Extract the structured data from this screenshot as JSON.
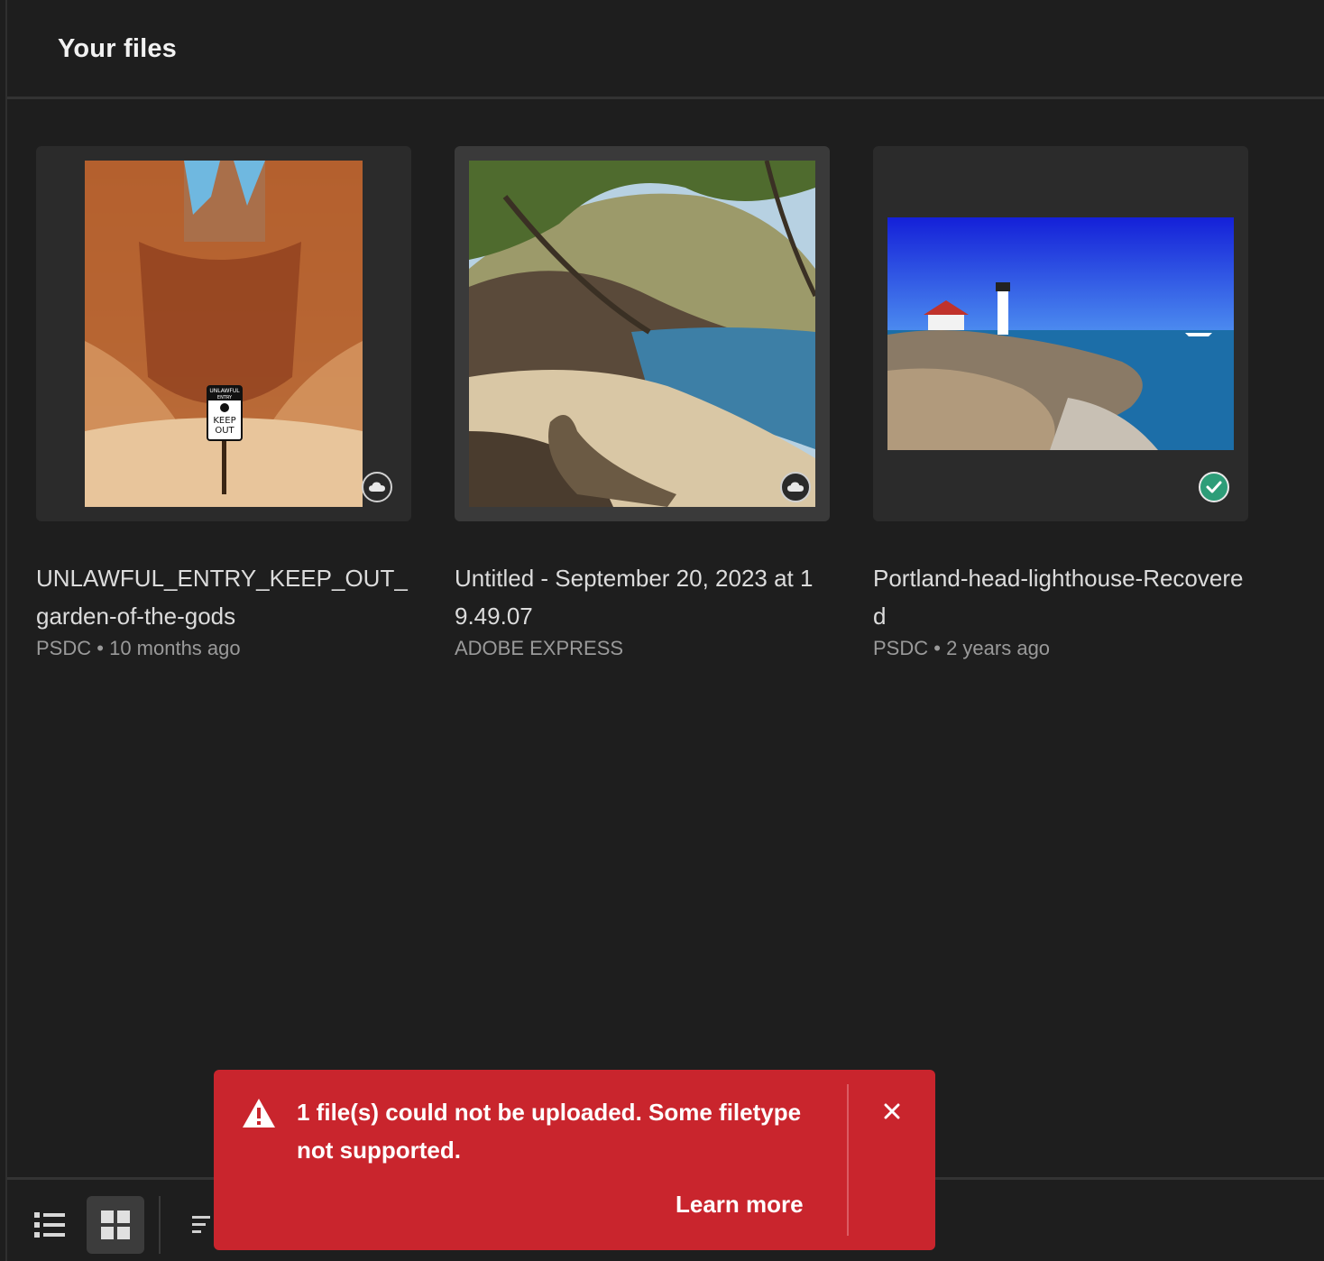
{
  "header": {
    "title": "Your files"
  },
  "files": [
    {
      "name": "UNLAWFUL_ENTRY_KEEP_OUT_garden-of-the-gods",
      "source": "PSDC",
      "modified": "10 months ago",
      "status": "cloud-icon"
    },
    {
      "name": "Untitled - September 20, 2023 at 19.49.07",
      "source": "ADOBE EXPRESS",
      "modified": "",
      "status": "cloud-icon"
    },
    {
      "name": "Portland-head-lighthouse-Recovered",
      "source": "PSDC",
      "modified": "2 years ago",
      "status": "check-icon"
    }
  ],
  "sign": {
    "line1": "UNLAWFUL",
    "line2": "ENTRY",
    "line3": "KEEP",
    "line4": "OUT"
  },
  "meta_separator": "•",
  "toast": {
    "message": "1 file(s) could not be uploaded. Some filetype not supported.",
    "action": "Learn more",
    "color": "#c9252d"
  },
  "colors": {
    "background": "#1e1e1e",
    "card": "#2b2b2b",
    "success": "#2d9d78"
  }
}
